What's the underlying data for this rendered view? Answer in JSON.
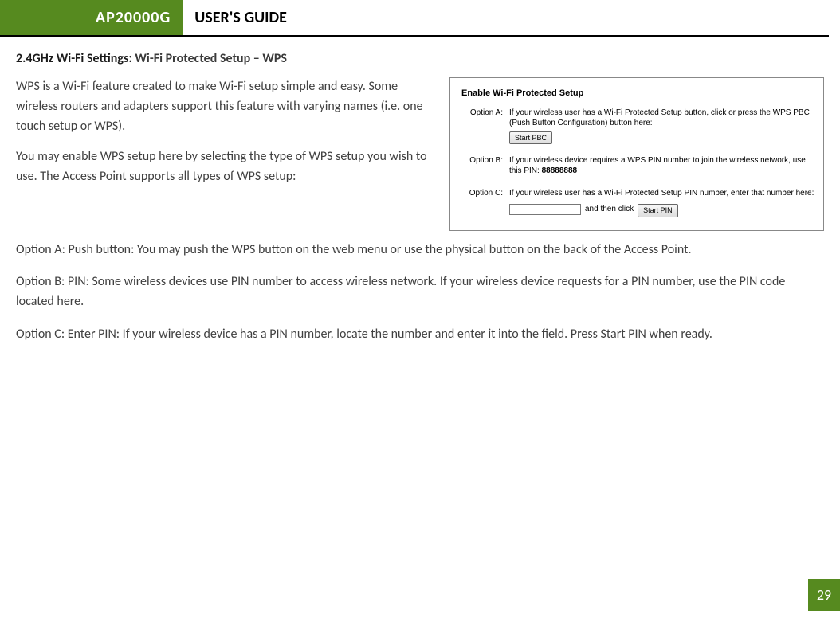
{
  "header": {
    "model": "AP20000G",
    "title": "USER'S GUIDE"
  },
  "section_heading": {
    "bold": "2.4GHz Wi-Fi Settings: ",
    "rest": "Wi-Fi Protected Setup – WPS"
  },
  "intro": {
    "p1": "WPS is a Wi-Fi feature created to make Wi-Fi setup simple and easy. Some wireless routers and adapters support this feature with varying names (i.e. one touch setup or WPS).",
    "p2": "You may enable WPS setup here by selecting the type of WPS setup you wish to use. The Access Point supports all types of WPS setup:"
  },
  "screenshot": {
    "title": "Enable Wi-Fi Protected Setup",
    "optA": {
      "label": "Option A:",
      "text": "If your wireless user has a Wi-Fi Protected Setup button, click or press the WPS PBC (Push Button Configuration) button here:",
      "button": "Start PBC"
    },
    "optB": {
      "label": "Option B:",
      "text_before": "If your wireless device requires a WPS PIN number to join the wireless network, use this PIN: ",
      "pin": "88888888"
    },
    "optC": {
      "label": "Option C:",
      "text": "If your wireless user has a Wi-Fi Protected Setup PIN number, enter that number here:",
      "between": "and then click",
      "button": "Start PIN"
    }
  },
  "body": {
    "optA": "Option A: Push button: You may push the WPS button on the web menu or use the physical button on the back of the Access Point.",
    "optB": "Option B: PIN: Some wireless devices use PIN number to access wireless network. If your wireless device requests for a PIN number, use the PIN code located here.",
    "optC": "Option C: Enter PIN: If your wireless device has a PIN number, locate the number and enter it into the field. Press Start PIN when ready."
  },
  "page_number": "29"
}
